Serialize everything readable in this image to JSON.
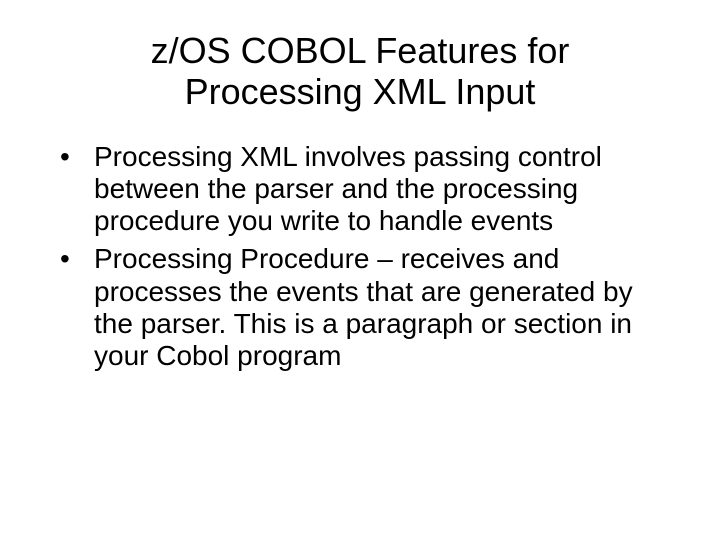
{
  "title": "z/OS COBOL Features for Processing XML Input",
  "bullets": [
    "Processing XML involves passing control between the parser and the processing procedure you write to handle events",
    "Processing Procedure – receives and processes the events that are generated by the parser.  This is a paragraph or section in your Cobol program"
  ]
}
